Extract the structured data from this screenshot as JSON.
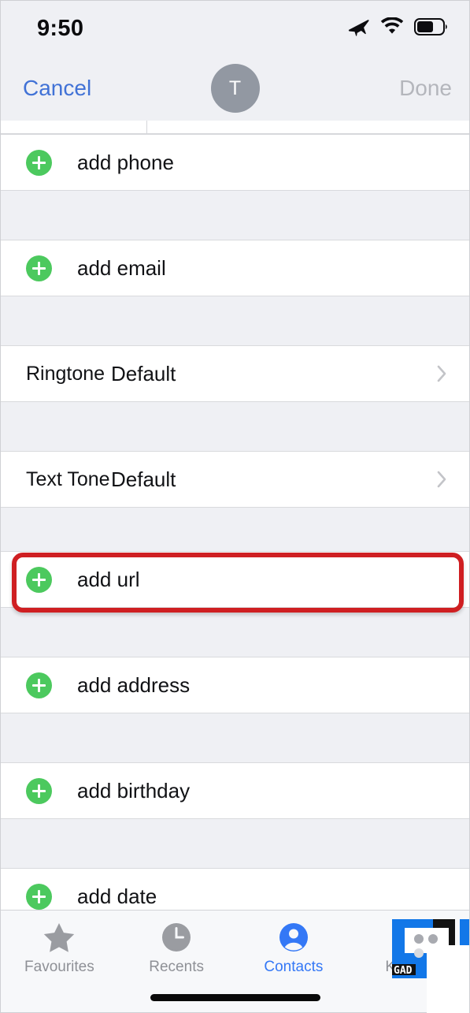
{
  "status_bar": {
    "time": "9:50",
    "icons": [
      "airplane-mode-icon",
      "wifi-icon",
      "battery-icon"
    ],
    "battery_level": 55
  },
  "nav_bar": {
    "cancel_label": "Cancel",
    "done_label": "Done",
    "avatar_initial": "T"
  },
  "colors": {
    "accent_blue": "#3478f6",
    "cancel_blue": "#4172d6",
    "add_green": "#4cc95e",
    "highlight_red": "#cf1f22",
    "group_background": "#eff0f4",
    "row_background": "#ffffff",
    "disabled_gray": "#b4b6bc"
  },
  "form": {
    "add_rows": [
      {
        "icon": "plus-icon",
        "label": "add phone"
      },
      {
        "icon": "plus-icon",
        "label": "add email"
      }
    ],
    "tone_rows": [
      {
        "label": "Ringtone",
        "value": "Default",
        "accessory": "chevron-right-icon",
        "highlighted": false
      },
      {
        "label": "Text Tone",
        "value": "Default",
        "accessory": "chevron-right-icon",
        "highlighted": true
      }
    ],
    "more_rows": [
      {
        "icon": "plus-icon",
        "label": "add url"
      },
      {
        "icon": "plus-icon",
        "label": "add address"
      },
      {
        "icon": "plus-icon",
        "label": "add birthday"
      },
      {
        "icon": "plus-icon",
        "label": "add date"
      }
    ]
  },
  "tab_bar": {
    "tabs": [
      {
        "label": "Favourites",
        "icon": "star-icon",
        "active": false
      },
      {
        "label": "Recents",
        "icon": "clock-icon",
        "active": false
      },
      {
        "label": "Contacts",
        "icon": "person-icon",
        "active": true
      },
      {
        "label": "Keypad",
        "icon": "keypad-icon",
        "active": false
      }
    ]
  },
  "watermark": {
    "text": "GAD"
  }
}
